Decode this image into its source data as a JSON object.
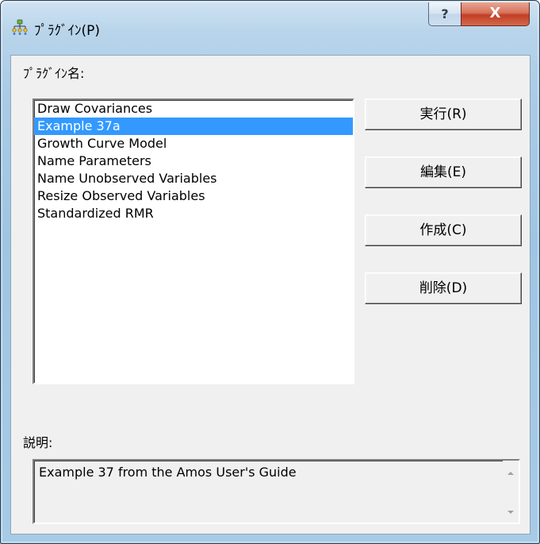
{
  "window": {
    "title": "ﾌﾟﾗｸﾞｲﾝ(P)",
    "help_label": "?",
    "close_label": "X",
    "icon": "plugin-tree-icon"
  },
  "plugin_list": {
    "label": "ﾌﾟﾗｸﾞｲﾝ名:",
    "items": [
      "Draw Covariances",
      "Example 37a",
      "Growth Curve Model",
      "Name Parameters",
      "Name Unobserved Variables",
      "Resize Observed Variables",
      "Standardized RMR"
    ],
    "selected_index": 1
  },
  "buttons": {
    "run": "実行(R)",
    "edit": "編集(E)",
    "create": "作成(C)",
    "delete": "削除(D)"
  },
  "description": {
    "label": "説明:",
    "text": "Example 37 from the Amos User's Guide"
  },
  "colors": {
    "selection": "#3399ff",
    "dialog_face": "#f0f0f0",
    "close_button": "#c23e25"
  }
}
